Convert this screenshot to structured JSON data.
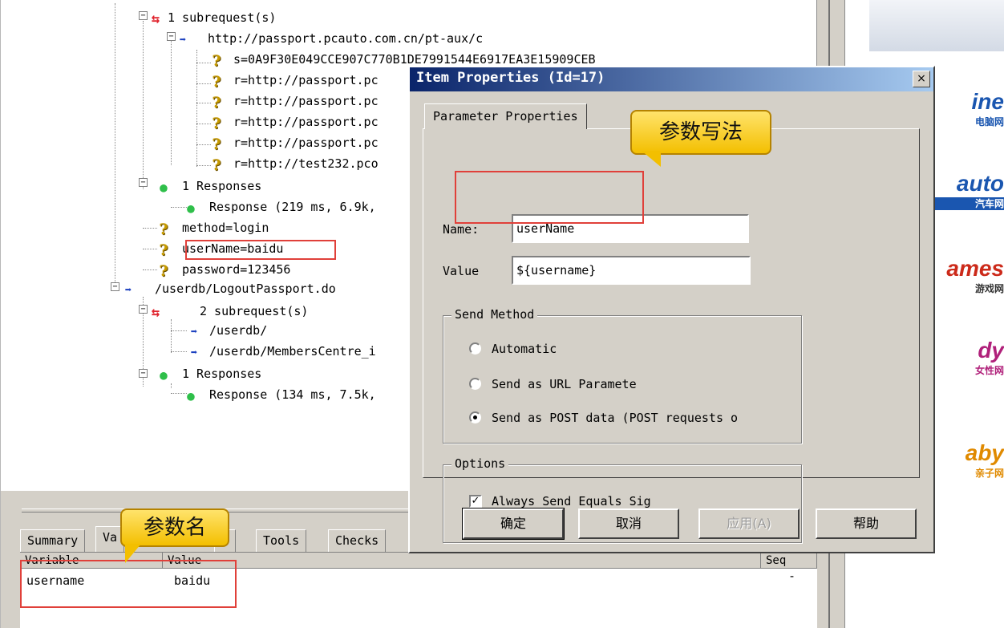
{
  "tree": {
    "subrequests_1": "1 subrequest(s)",
    "url_1": "http://passport.pcauto.com.cn/pt-aux/c",
    "s_param": "s=0A9F30E049CCE907C770B1DE7991544E6917EA3E15909CEB",
    "r_params": [
      "r=http://passport.pc",
      "r=http://passport.pc",
      "r=http://passport.pc",
      "r=http://passport.pc",
      "r=http://test232.pco"
    ],
    "responses_1": "1 Responses",
    "response_1": "Response (219 ms, 6.9k,",
    "method": "method=login",
    "username_param": "userName=baidu",
    "password": "password=123456",
    "logout": "/userdb/LogoutPassport.do",
    "subrequests_2": "2 subrequest(s)",
    "userdb": "/userdb/",
    "members": "/userdb/MembersCentre_i",
    "responses_2": "1 Responses",
    "response_2": "Response (134 ms, 7.5k,"
  },
  "dialog": {
    "title": "Item Properties (Id=17)",
    "close": "×",
    "tab": "Parameter Properties",
    "name_label": "Name:",
    "name_value": "userName",
    "value_label": "Value",
    "value_value": "${username}",
    "send_method_legend": "Send Method",
    "radio_automatic": "Automatic",
    "radio_url": "Send as URL Paramete",
    "radio_post": "Send as POST data (POST requests o",
    "options_legend": "Options",
    "check_equals": "Always Send Equals Sig",
    "btn_ok": "确定",
    "btn_cancel": "取消",
    "btn_apply": "应用(A)",
    "btn_help": "帮助"
  },
  "bottom": {
    "tabs": [
      "Summary",
      "Va",
      "h",
      "Tools",
      "Checks"
    ],
    "col_variable": "Variable",
    "col_value": "Value",
    "col_seq": "Seq",
    "row_variable": "username",
    "row_value": "baidu",
    "row_seq": "-"
  },
  "annotations": {
    "callout_value": "参数写法",
    "callout_name": "参数名"
  },
  "right_logos": [
    {
      "big": "ine",
      "small": "电脑网",
      "color": "#1a56b0"
    },
    {
      "big": "auto",
      "small": "汽车网",
      "color": "#1a56b0"
    },
    {
      "big": "ames",
      "small": "游戏网",
      "color": "#cc2a1a"
    },
    {
      "big": "dy",
      "small": "女性网",
      "color": "#b0207a"
    },
    {
      "big": "aby",
      "small": "亲子网",
      "color": "#e08a00"
    }
  ],
  "icons": {
    "subrequest": "subrequest-icon",
    "request": "request-arrow-icon",
    "parameter": "parameter-question-icon",
    "response": "response-dot-icon"
  }
}
